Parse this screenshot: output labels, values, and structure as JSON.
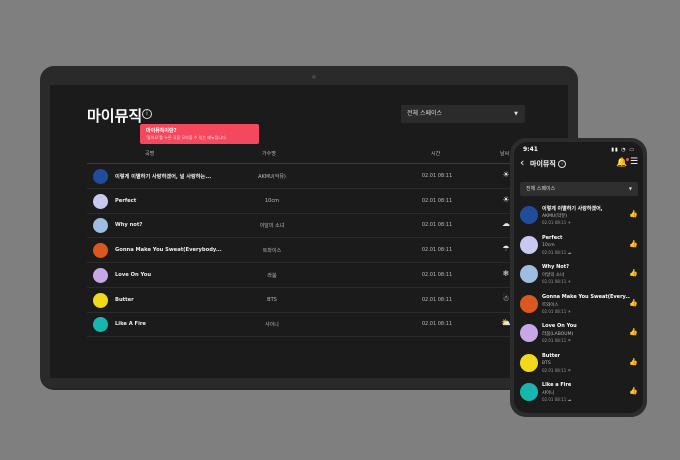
{
  "tablet": {
    "title": "마이뮤직",
    "info_icon": "info-icon",
    "space_select": "전체 스페이스",
    "tooltip": {
      "title": "마이뮤직이란?",
      "text": "'좋아요'를 누른 곡을 모아볼 수 있는 메뉴입니다."
    },
    "columns": {
      "song": "곡명",
      "artist": "가수명",
      "time": "시간",
      "weather": "날씨"
    },
    "rows": [
      {
        "song": "이렇게 이별하기 사랑하겠어, 널 사랑하는...",
        "artist": "AKMU(악뮤)",
        "time": "02.01 08:11",
        "weather": "☀",
        "thumb": "#1f4d9c"
      },
      {
        "song": "Perfect",
        "artist": "10cm",
        "time": "02.01 08:11",
        "weather": "☀",
        "thumb": "#c9c9f0"
      },
      {
        "song": "Why not?",
        "artist": "이달의 소녀",
        "time": "02.01 08:11",
        "weather": "☁",
        "thumb": "#9ebde0"
      },
      {
        "song": "Gonna Make You Sweat(Everybody...",
        "artist": "트와이스",
        "time": "02.01 08:11",
        "weather": "☂",
        "thumb": "#d9581f"
      },
      {
        "song": "Love On You",
        "artist": "라붐",
        "time": "02.01 08:11",
        "weather": "❄",
        "thumb": "#c8a7e6"
      },
      {
        "song": "Butter",
        "artist": "BTS",
        "time": "02.01 08:11",
        "weather": "☃",
        "thumb": "#f2d91c"
      },
      {
        "song": "Like A Fire",
        "artist": "샤이니",
        "time": "02.01 08:11",
        "weather": "⛅",
        "thumb": "#17b7b0"
      }
    ]
  },
  "phone": {
    "status_time": "9:41",
    "status_icons": "▮▮ ◔ ▭",
    "title": "마이뮤직",
    "space_select": "전체 스페이스",
    "rows": [
      {
        "song": "이렇게 이별하기 사랑하겠어,",
        "artist": "AKMU(악뮤)",
        "date": "02.01 08:11 ☀",
        "thumb": "#1f4d9c"
      },
      {
        "song": "Perfect",
        "artist": "10cm",
        "date": "02.01 08:11 ☁",
        "thumb": "#c9c9f0"
      },
      {
        "song": "Why Not?",
        "artist": "이달의 소녀",
        "date": "02.01 08:11 ☀",
        "thumb": "#9ebde0"
      },
      {
        "song": "Gonna Make You Sweat(Every...",
        "artist": "트와이스",
        "date": "02.01 08:11 ☀",
        "thumb": "#d9581f"
      },
      {
        "song": "Love On You",
        "artist": "라붐(LABOUM)",
        "date": "02.01 08:11 ☂",
        "thumb": "#c8a7e6"
      },
      {
        "song": "Butter",
        "artist": "BTS",
        "date": "02.01 08:11 ☂",
        "thumb": "#f2d91c"
      },
      {
        "song": "Like a Fire",
        "artist": "샤이니",
        "date": "02.01 08:11 ☁",
        "thumb": "#17b7b0"
      }
    ]
  },
  "colors": {
    "accent": "#f4485e",
    "bg": "#1b1b1b",
    "page": "#7f7f7f"
  }
}
